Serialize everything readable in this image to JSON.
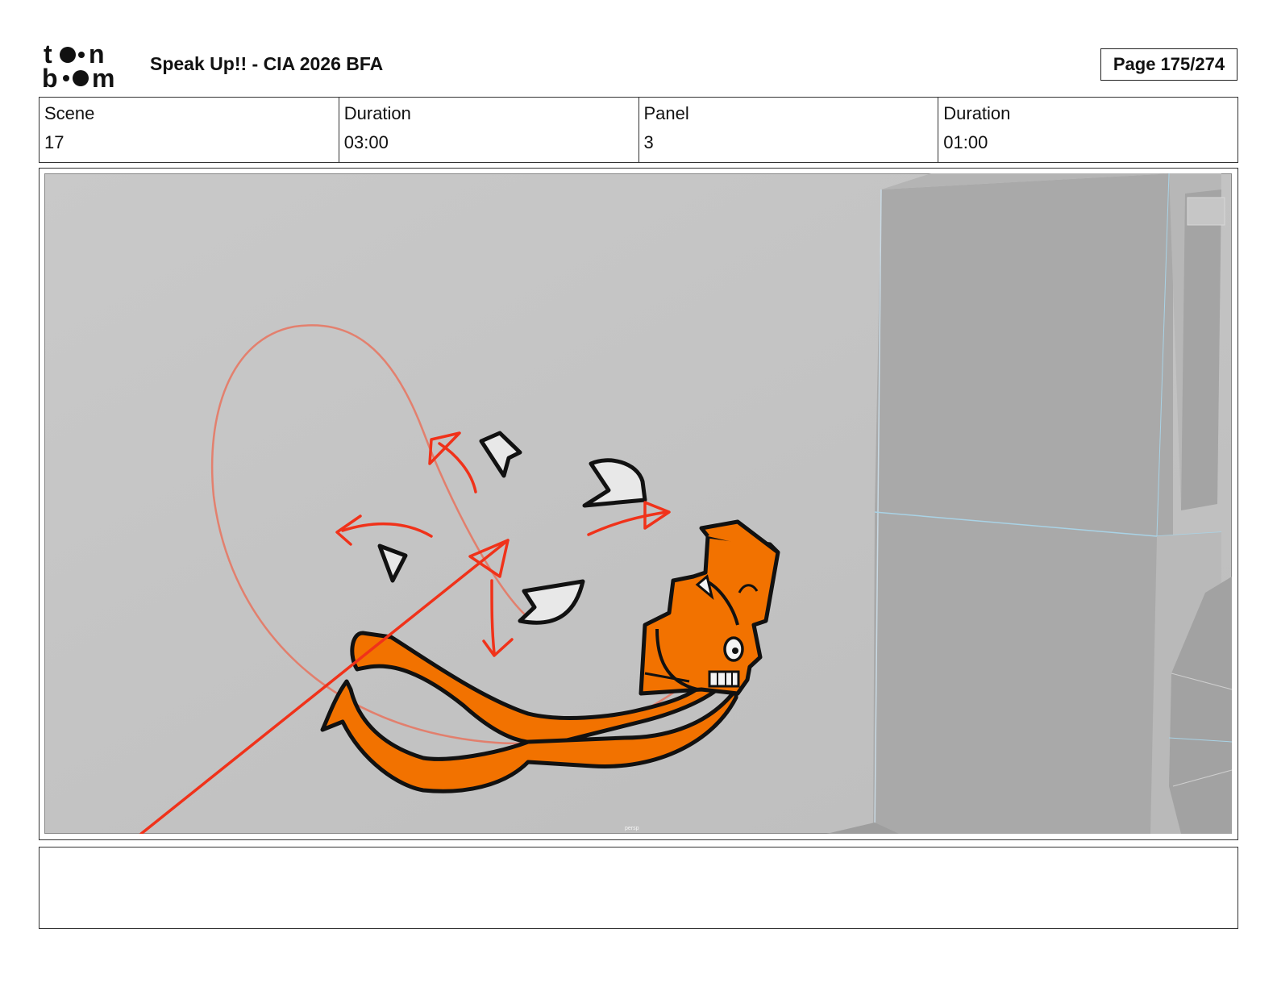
{
  "header": {
    "logo_text": "toonboom",
    "project_title": "Speak Up!! - CIA 2026 BFA",
    "page_indicator": "Page 175/274"
  },
  "info": {
    "scene_label": "Scene",
    "scene_value": "17",
    "scene_duration_label": "Duration",
    "scene_duration_value": "03:00",
    "panel_label": "Panel",
    "panel_value": "3",
    "panel_duration_label": "Duration",
    "panel_duration_value": "01:00"
  },
  "panel": {
    "camera_label": "persp",
    "colors": {
      "background": "#c2c2c2",
      "wall": "#aaaaaa",
      "character": "#f27200",
      "arrows": "#f0321a",
      "motion_loop": "#e8735e"
    }
  },
  "notes": {
    "text": ""
  }
}
